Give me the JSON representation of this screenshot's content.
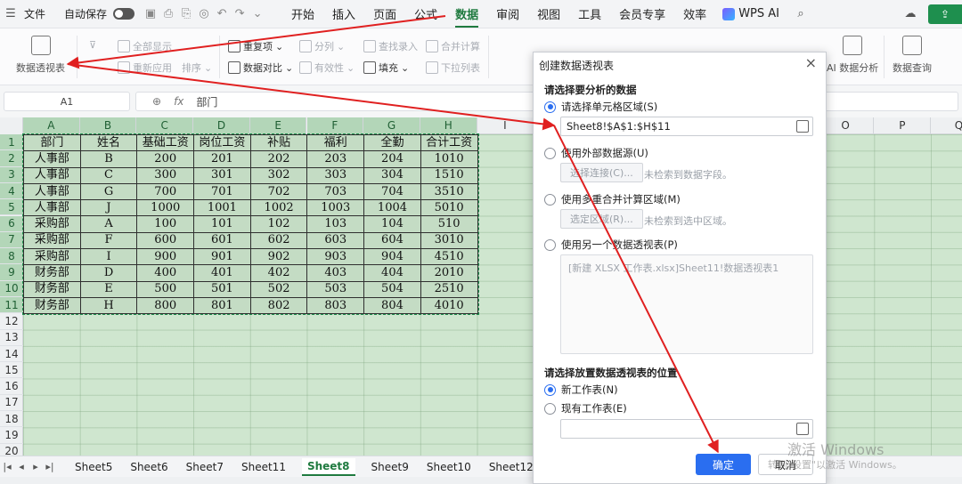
{
  "menubar": {
    "file_label": "文件",
    "autosave_label": "自动保存",
    "tabs": [
      "开始",
      "插入",
      "页面",
      "公式",
      "数据",
      "审阅",
      "视图",
      "工具",
      "会员专享",
      "效率"
    ],
    "active_tab": "数据",
    "wps_ai_label": "WPS AI"
  },
  "ribbon": {
    "pivot_table": "数据透视表",
    "show_all": "全部显示",
    "reapply": "重新应用",
    "sort": "排序",
    "duplicates": "重复项",
    "compare": "数据对比",
    "split": "分列",
    "validity": "有效性",
    "find_entry": "查找录入",
    "fill": "填充",
    "consolidate": "合并计算",
    "dropdown": "下拉列表",
    "ai_analysis": "AI 数据分析",
    "data_query": "数据查询"
  },
  "formula_bar": {
    "cell_ref": "A1",
    "formula": "部门"
  },
  "columns": [
    "A",
    "B",
    "C",
    "D",
    "E",
    "F",
    "G",
    "H",
    "I",
    "J",
    "K",
    "L",
    "M",
    "N",
    "O",
    "P",
    "Q"
  ],
  "rows": [
    "1",
    "2",
    "3",
    "4",
    "5",
    "6",
    "7",
    "8",
    "9",
    "10",
    "11",
    "12",
    "13",
    "14",
    "15",
    "16",
    "17",
    "18",
    "19",
    "20"
  ],
  "table": [
    [
      "部门",
      "姓名",
      "基础工资",
      "岗位工资",
      "补贴",
      "福利",
      "全勤",
      "合计工资"
    ],
    [
      "人事部",
      "B",
      "200",
      "201",
      "202",
      "203",
      "204",
      "1010"
    ],
    [
      "人事部",
      "C",
      "300",
      "301",
      "302",
      "303",
      "304",
      "1510"
    ],
    [
      "人事部",
      "G",
      "700",
      "701",
      "702",
      "703",
      "704",
      "3510"
    ],
    [
      "人事部",
      "J",
      "1000",
      "1001",
      "1002",
      "1003",
      "1004",
      "5010"
    ],
    [
      "采购部",
      "A",
      "100",
      "101",
      "102",
      "103",
      "104",
      "510"
    ],
    [
      "采购部",
      "F",
      "600",
      "601",
      "602",
      "603",
      "604",
      "3010"
    ],
    [
      "采购部",
      "I",
      "900",
      "901",
      "902",
      "903",
      "904",
      "4510"
    ],
    [
      "财务部",
      "D",
      "400",
      "401",
      "402",
      "403",
      "404",
      "2010"
    ],
    [
      "财务部",
      "E",
      "500",
      "501",
      "502",
      "503",
      "504",
      "2510"
    ],
    [
      "财务部",
      "H",
      "800",
      "801",
      "802",
      "803",
      "804",
      "4010"
    ]
  ],
  "sheets": [
    "Sheet5",
    "Sheet6",
    "Sheet7",
    "Sheet11",
    "Sheet8",
    "Sheet9",
    "Sheet10",
    "Sheet12"
  ],
  "active_sheet": "Sheet8",
  "dialog": {
    "title": "创建数据透视表",
    "section1": "请选择要分析的数据",
    "opt_range": "请选择单元格区域(S)",
    "range_value": "Sheet8!$A$1:$H$11",
    "opt_external": "使用外部数据源(U)",
    "choose_conn": "选择连接(C)...",
    "no_fields": "未检索到数据字段。",
    "opt_multi": "使用多重合并计算区域(M)",
    "choose_area": "选定区域(R)...",
    "no_area": "未检索到选中区域。",
    "opt_other": "使用另一个数据透视表(P)",
    "other_item": "[新建 XLSX 工作表.xlsx]Sheet11!数据透视表1",
    "section2": "请选择放置数据透视表的位置",
    "opt_new_sheet": "新工作表(N)",
    "opt_existing": "现有工作表(E)",
    "ok": "确定",
    "cancel": "取消"
  },
  "watermark": {
    "line1": "激活 Windows",
    "line2": "转到\"设置\"以激活 Windows。"
  },
  "colors": {
    "accent_green": "#1f7a3f",
    "selection_fill": "#c4dcc4",
    "annotation_red": "#e02020",
    "primary_blue": "#2a6ef0"
  }
}
